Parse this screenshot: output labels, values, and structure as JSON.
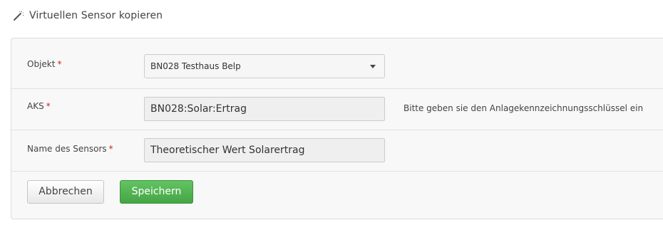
{
  "header": {
    "icon": "magic-wand-icon",
    "title": "Virtuellen Sensor kopieren"
  },
  "form": {
    "objekt": {
      "label": "Objekt",
      "required_mark": "*",
      "selected": "BN028 Testhaus Belp"
    },
    "aks": {
      "label": "AKS",
      "required_mark": "*",
      "value": "BN028:Solar:Ertrag",
      "help": "Bitte geben sie den Anlagekennzeichnungsschlüssel ein"
    },
    "name": {
      "label": "Name des Sensors",
      "required_mark": "*",
      "value": "Theoretischer Wert Solarertrag"
    }
  },
  "actions": {
    "cancel_label": "Abbrechen",
    "save_label": "Speichern"
  },
  "colors": {
    "save_button": "#5cb85c",
    "required": "#cc2222",
    "panel_bg": "#f8f8f8"
  }
}
